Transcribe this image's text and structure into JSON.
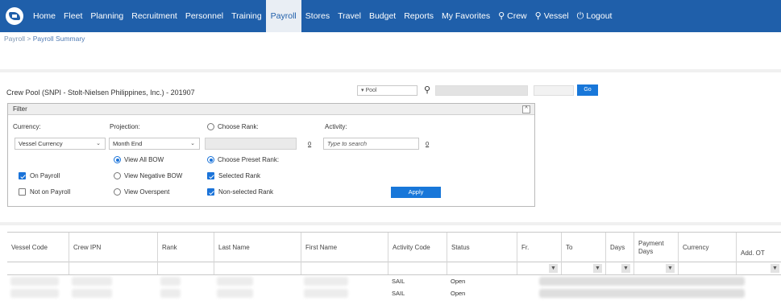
{
  "nav": {
    "items": [
      {
        "label": "Home",
        "active": false
      },
      {
        "label": "Fleet",
        "active": false
      },
      {
        "label": "Planning",
        "active": false
      },
      {
        "label": "Recruitment",
        "active": false
      },
      {
        "label": "Personnel",
        "active": false
      },
      {
        "label": "Training",
        "active": false
      },
      {
        "label": "Payroll",
        "active": true
      },
      {
        "label": "Stores",
        "active": false
      },
      {
        "label": "Travel",
        "active": false
      },
      {
        "label": "Budget",
        "active": false
      },
      {
        "label": "Reports",
        "active": false
      },
      {
        "label": "My Favorites",
        "active": false
      },
      {
        "label": "Crew",
        "active": false,
        "icon": "search-icon"
      },
      {
        "label": "Vessel",
        "active": false,
        "icon": "search-icon"
      },
      {
        "label": "Logout",
        "active": false,
        "icon": "power-icon"
      }
    ]
  },
  "breadcrumb": {
    "root": "Payroll",
    "separator": ">",
    "current": "Payroll Summary"
  },
  "header": {
    "pool_title": "Crew Pool (SNPI - Stolt-Nielsen Philippines, Inc.) - 201907",
    "pool_select": "Pool",
    "go_label": "Go"
  },
  "filter": {
    "title": "Filter",
    "collapse_symbol": "^",
    "currency_label": "Currency:",
    "currency_value": "Vessel Currency",
    "projection_label": "Projection:",
    "projection_value": "Month End",
    "choose_rank_label": "Choose Rank:",
    "activity_label": "Activity:",
    "rank_count": "0",
    "activity_placeholder": "Type to search",
    "activity_count": "0",
    "view_all_bow": "View All BOW",
    "view_negative_bow": "View Negative BOW",
    "view_overspent": "View Overspent",
    "choose_preset_rank": "Choose Preset Rank:",
    "selected_rank": "Selected Rank",
    "non_selected_rank": "Non-selected Rank",
    "on_payroll": "On Payroll",
    "not_on_payroll": "Not on Payroll",
    "apply_label": "Apply"
  },
  "grid": {
    "columns": [
      "Vessel Code",
      "Crew IPN",
      "Rank",
      "Last Name",
      "First Name",
      "Activity Code",
      "Status",
      "Fr.",
      "To",
      "Days",
      "Payment Days",
      "Currency",
      "Add. OT"
    ],
    "rows": [
      {
        "activity_code": "SAIL",
        "status": "Open"
      },
      {
        "activity_code": "SAIL",
        "status": "Open"
      }
    ]
  },
  "colors": {
    "nav_bg": "#1f5faa",
    "accent": "#1877d9"
  }
}
